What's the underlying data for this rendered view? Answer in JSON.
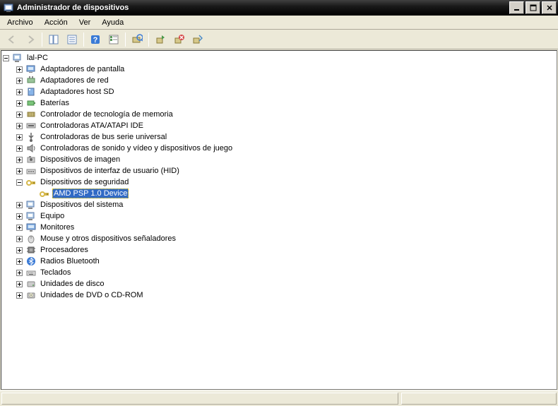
{
  "window": {
    "title": "Administrador de dispositivos",
    "min": "_",
    "max": "□",
    "close": "✕"
  },
  "menu": {
    "file": "Archivo",
    "action": "Acción",
    "view": "Ver",
    "help": "Ayuda"
  },
  "tree": {
    "root": "lal-PC",
    "displayAdapters": "Adaptadores de pantalla",
    "networkAdapters": "Adaptadores de red",
    "sdHostAdapters": "Adaptadores host SD",
    "batteries": "Baterías",
    "memoryTech": "Controlador de tecnología de memoria",
    "ataAtapi": "Controladoras ATA/ATAPI IDE",
    "usbControllers": "Controladoras de bus serie universal",
    "soundVideoGame": "Controladoras de sonido y vídeo y dispositivos de juego",
    "imaging": "Dispositivos de imagen",
    "hid": "Dispositivos de interfaz de usuario (HID)",
    "security": "Dispositivos de seguridad",
    "amdPsp": "AMD PSP 1.0 Device",
    "systemDevices": "Dispositivos del sistema",
    "computer": "Equipo",
    "monitors": "Monitores",
    "mice": "Mouse y otros dispositivos señaladores",
    "processors": "Procesadores",
    "bluetooth": "Radios Bluetooth",
    "keyboards": "Teclados",
    "diskDrives": "Unidades de disco",
    "dvdCd": "Unidades de DVD o CD-ROM"
  },
  "icons": {
    "expander_plus": "+",
    "expander_minus": "−"
  },
  "colors": {
    "selection": "#316ac5",
    "bg": "#ece9d8"
  }
}
